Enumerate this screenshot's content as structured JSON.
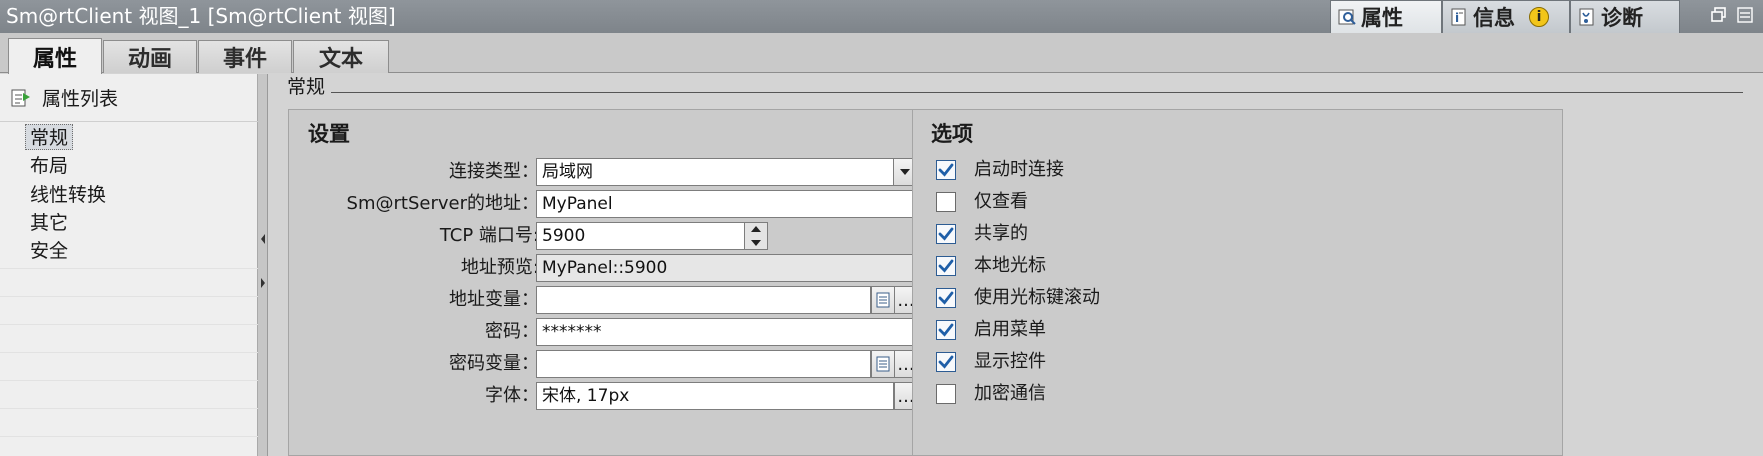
{
  "window": {
    "title": "Sm@rtClient 视图_1 [Sm@rtClient 视图]",
    "tabs": [
      {
        "label": "属性",
        "icon": "properties-icon",
        "active": true
      },
      {
        "label": "信息",
        "icon": "info-icon",
        "active": false
      },
      {
        "label": "诊断",
        "icon": "diagnostics-icon",
        "active": false
      }
    ]
  },
  "main_tabs": [
    "属性",
    "动画",
    "事件",
    "文本"
  ],
  "left_nav": {
    "header": "属性列表",
    "items": [
      "常规",
      "布局",
      "线性转换",
      "其它",
      "安全"
    ],
    "selected": "常规"
  },
  "section": {
    "title": "常规"
  },
  "settings": {
    "title": "设置",
    "connection_type_label": "连接类型：",
    "connection_type_value": "局域网",
    "server_address_label": "Sm@rtServer的地址：",
    "server_address_value": "MyPanel",
    "tcp_port_label": "TCP 端口号:",
    "tcp_port_value": "5900",
    "address_preview_label": "地址预览:",
    "address_preview_value": "MyPanel::5900",
    "address_variable_label": "地址变量：",
    "address_variable_value": "",
    "password_label": "密码：",
    "password_value": "*******",
    "password_variable_label": "密码变量：",
    "password_variable_value": "",
    "font_label": "字体：",
    "font_value": "宋体, 17px",
    "browse_button": "..."
  },
  "options": {
    "title": "选项",
    "items": [
      {
        "label": "启动时连接",
        "checked": true
      },
      {
        "label": "仅查看",
        "checked": false
      },
      {
        "label": "共享的",
        "checked": true
      },
      {
        "label": "本地光标",
        "checked": true
      },
      {
        "label": "使用光标键滚动",
        "checked": true
      },
      {
        "label": "启用菜单",
        "checked": true
      },
      {
        "label": "显示控件",
        "checked": true
      },
      {
        "label": "加密通信",
        "checked": false
      }
    ]
  },
  "colors": {
    "check_blue": "#1f5fa8",
    "title_bar": "#7e848a",
    "panel_bg": "#cbcbcb"
  }
}
